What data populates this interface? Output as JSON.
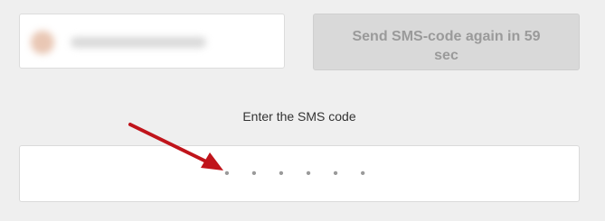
{
  "phone_field": {
    "redacted_value": "•••••••••••"
  },
  "resend_button": {
    "label": "Send SMS-code again in 59 sec",
    "countdown_seconds": 59
  },
  "code_entry": {
    "label": "Enter the SMS code",
    "placeholder": "• • • • • •",
    "value": ""
  },
  "annotation": {
    "arrow_color": "#c0141b"
  },
  "colors": {
    "page_background": "#efefef",
    "disabled_button_bg": "#d9d9d9",
    "disabled_button_text": "#9a9a9a"
  }
}
